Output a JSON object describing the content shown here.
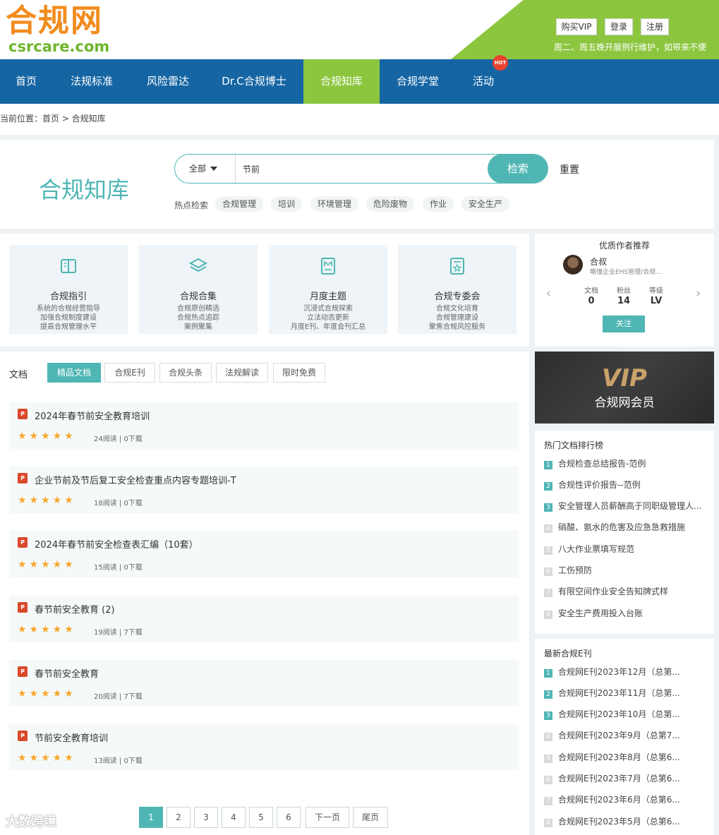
{
  "header": {
    "logo_cn": "合规网",
    "logo_en": "csrcare.com",
    "buy_vip": "购买VIP",
    "login": "登录",
    "register": "注册",
    "notice": "周二、周五晚开展例行维护，如带来不便"
  },
  "nav": {
    "items": [
      "首页",
      "法规标准",
      "风险雷达",
      "Dr.C合规博士",
      "合规知库",
      "合规学堂",
      "活动"
    ],
    "active": "合规知库",
    "hot_badge": "HOT"
  },
  "breadcrumb": "当前位置：首页 > 合规知库",
  "search": {
    "title": "合规知库",
    "category": "全部",
    "value": "节前",
    "button": "检索",
    "reset": "重置",
    "hot_label": "热点检索",
    "hot_tags": [
      "合规管理",
      "培训",
      "环境管理",
      "危险废物",
      "作业",
      "安全生产"
    ]
  },
  "categories": [
    {
      "title": "合规指引",
      "lines": [
        "系统的合规经营指导",
        "加强合规制度建设",
        "提高合规管理水平"
      ],
      "icon": "book-icon"
    },
    {
      "title": "合规合集",
      "lines": [
        "合规原创精选",
        "合规热点追踪",
        "案例聚集"
      ],
      "icon": "layers-icon"
    },
    {
      "title": "月度主题",
      "lines": [
        "沉浸式合规探索",
        "立法动态更新",
        "月度E刊、年度会刊汇总"
      ],
      "icon": "calendar-icon"
    },
    {
      "title": "合规专委会",
      "lines": [
        "合规文化培育",
        "合规管理建设",
        "聚焦合规风控服务"
      ],
      "icon": "badge-icon"
    }
  ],
  "author": {
    "heading": "优质作者推荐",
    "name": "合叔",
    "desc": "略懂企业EHS管理/合规...",
    "stats": [
      {
        "label": "文档",
        "value": "0"
      },
      {
        "label": "粉丝",
        "value": "14"
      },
      {
        "label": "等级",
        "value": "LV"
      }
    ],
    "follow": "关注"
  },
  "docs": {
    "label": "文档",
    "tabs": [
      "精品文档",
      "合规E刊",
      "合规头条",
      "法规解读",
      "限时免费"
    ],
    "active_tab": "精品文档",
    "items": [
      {
        "title": "2024年春节前安全教育培训",
        "meta": "24阅读 | 0下载",
        "rating": 5
      },
      {
        "title": "企业节前及节后复工安全检查重点内容专题培训-T",
        "meta": "18阅读 | 0下载",
        "rating": 5
      },
      {
        "title": "2024年春节前安全检查表汇编（10套）",
        "meta": "15阅读 | 0下载",
        "rating": 5
      },
      {
        "title": "春节前安全教育 (2)",
        "meta": "19阅读 | 7下载",
        "rating": 5
      },
      {
        "title": "春节前安全教育",
        "meta": "20阅读 | 7下载",
        "rating": 5
      },
      {
        "title": "节前安全教育培训",
        "meta": "13阅读 | 0下载",
        "rating": 5
      }
    ]
  },
  "pagination": {
    "pages": [
      "1",
      "2",
      "3",
      "4",
      "5",
      "6"
    ],
    "current": "1",
    "next": "下一页",
    "last": "尾页"
  },
  "vip": {
    "logo": "VIP",
    "text": "合规网会员"
  },
  "hot_ranking": {
    "heading": "热门文档排行榜",
    "items": [
      "合规检查总结报告-范例",
      "合规性评价报告--范例",
      "安全管理人员薪酬高于同职级管理人...",
      "硝酸、氨水的危害及应急急救措施",
      "八大作业票填写规范",
      "工伤预防",
      "有限空间作业安全告知牌式样",
      "安全生产费用投入台账"
    ]
  },
  "latest_eperiodical": {
    "heading": "最新合规E刊",
    "items": [
      "合规网E刊2023年12月（总第...",
      "合规网E刊2023年11月（总第...",
      "合规网E刊2023年10月（总第...",
      "合规网E刊2023年9月（总第7...",
      "合规网E刊2023年8月（总第6...",
      "合规网E刊2023年7月（总第6...",
      "合规网E刊2023年6月（总第6...",
      "合规网E刊2023年5月（总第6..."
    ]
  },
  "watermark": "大数跨境",
  "colors": {
    "teal": "#4fb6b4",
    "nav_blue": "#1565a3",
    "green": "#8cc63f",
    "orange": "#f28c1e",
    "star": "#f4a82a"
  }
}
